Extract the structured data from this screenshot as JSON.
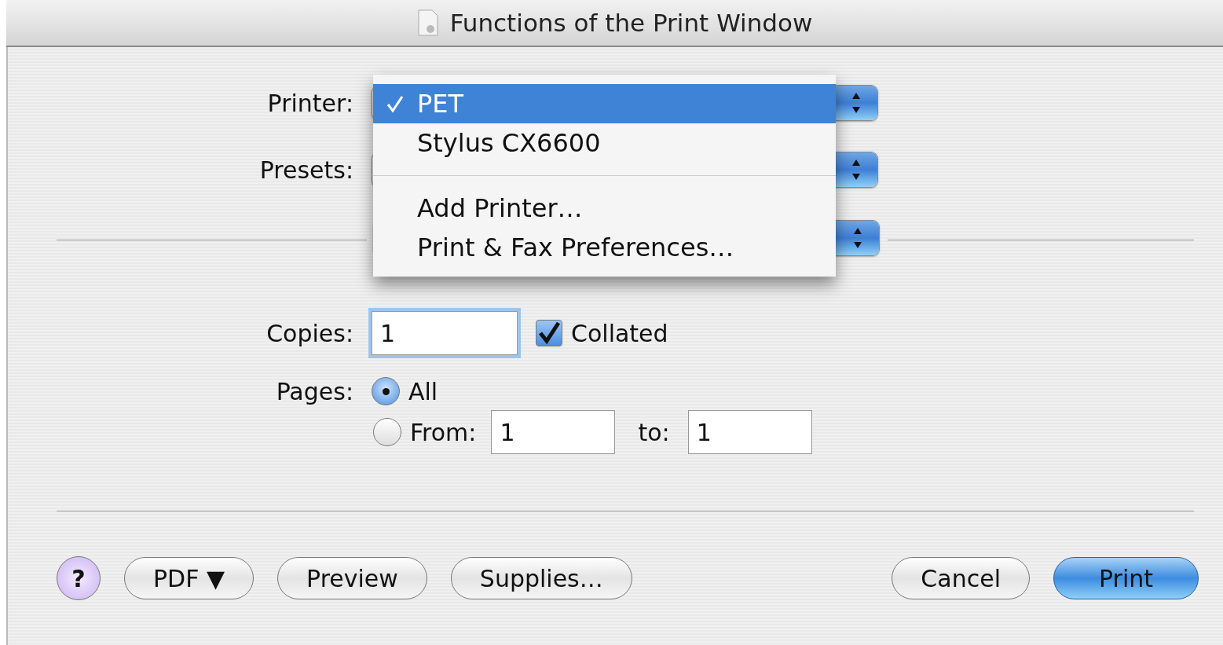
{
  "window": {
    "title": "Functions of the Print Window"
  },
  "printer": {
    "label": "Printer:"
  },
  "presets": {
    "label": "Presets:"
  },
  "printer_menu": {
    "items": [
      {
        "kind": "item",
        "label": "PET",
        "selected": true
      },
      {
        "kind": "item",
        "label": "Stylus CX6600",
        "selected": false
      },
      {
        "kind": "separator"
      },
      {
        "kind": "item",
        "label": "Add Printer…",
        "selected": false
      },
      {
        "kind": "item",
        "label": "Print & Fax Preferences…",
        "selected": false
      }
    ]
  },
  "copies": {
    "label": "Copies:",
    "value": "1",
    "collated": {
      "label": "Collated",
      "checked": true
    }
  },
  "pages": {
    "label": "Pages:",
    "options": [
      {
        "label": "All",
        "selected": true
      },
      {
        "label": "From:",
        "selected": false
      }
    ],
    "from": "1",
    "to_label": "to:",
    "to": "1"
  },
  "buttons": [
    {
      "kind": "help",
      "label": "?"
    },
    {
      "kind": "normal",
      "label": "PDF ▼"
    },
    {
      "kind": "normal",
      "label": "Preview"
    },
    {
      "kind": "normal",
      "label": "Supplies…"
    },
    {
      "kind": "spacer"
    },
    {
      "kind": "normal",
      "label": "Cancel"
    },
    {
      "kind": "default",
      "label": "Print"
    }
  ]
}
